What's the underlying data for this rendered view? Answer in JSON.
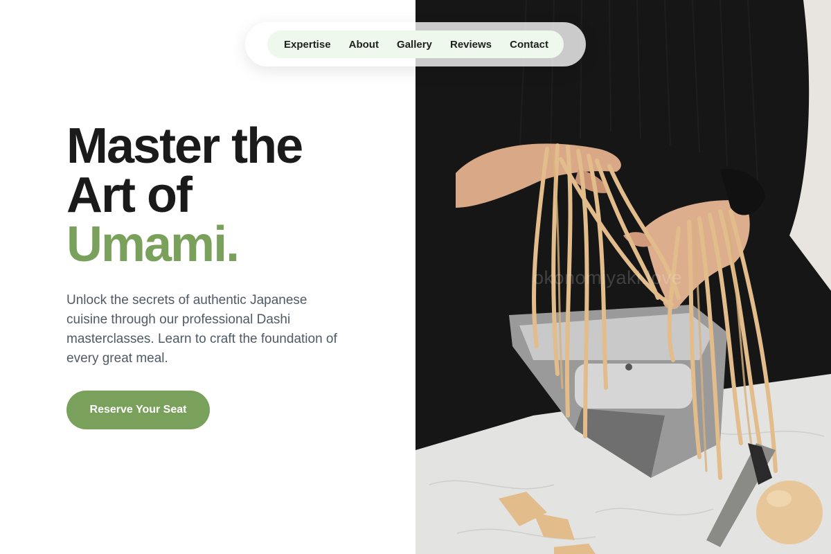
{
  "nav": {
    "items": [
      {
        "label": "Expertise"
      },
      {
        "label": "About"
      },
      {
        "label": "Gallery"
      },
      {
        "label": "Reviews"
      },
      {
        "label": "Contact"
      }
    ]
  },
  "hero": {
    "title_line1": "Master the",
    "title_line2": "Art of",
    "title_accent": "Umami.",
    "subtitle": "Unlock the secrets of authentic Japanese cuisine through our professional Dashi masterclasses. Learn to craft the foundation of every great meal.",
    "cta_label": "Reserve Your Seat"
  },
  "photo": {
    "watermark": "okonomiyaki.love"
  },
  "colors": {
    "accent": "#7aa15b",
    "nav_bg": "#eef8ec",
    "heading": "#1a1a1a",
    "body_text": "#4f5a66"
  }
}
